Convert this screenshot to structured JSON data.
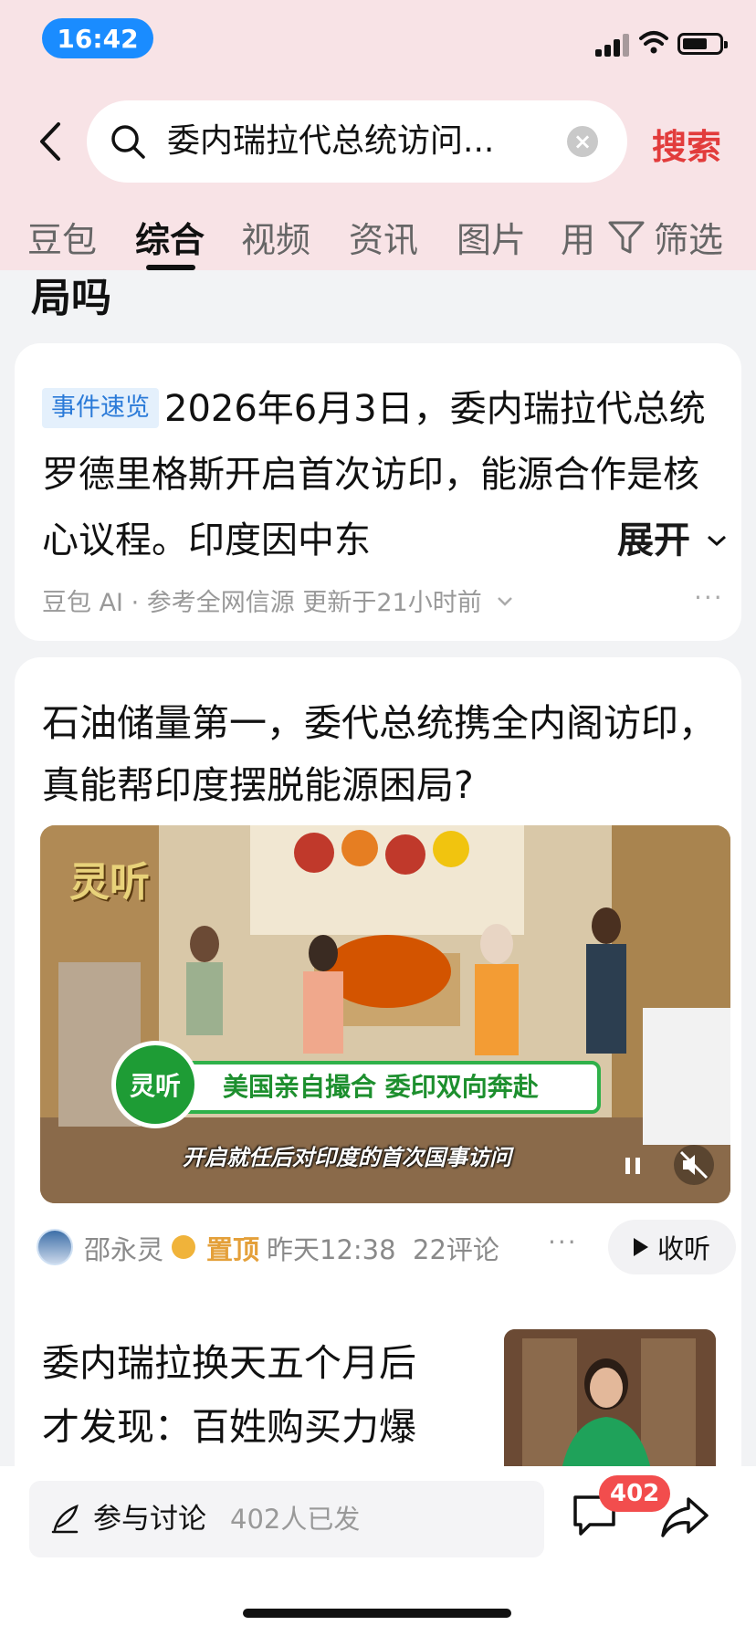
{
  "status_bar": {
    "time": "16:42"
  },
  "search": {
    "query": "委内瑞拉代总统访问...",
    "submit_label": "搜索"
  },
  "tabs": [
    {
      "label": "豆包"
    },
    {
      "label": "综合",
      "active": true
    },
    {
      "label": "视频"
    },
    {
      "label": "资讯"
    },
    {
      "label": "图片"
    },
    {
      "label": "用"
    }
  ],
  "filter_label": "筛选",
  "partial_title": "局吗",
  "ai_summary": {
    "badge": "事件速览",
    "body": "2026年6月3日，委内瑞拉代总统罗德里格斯开启首次访印，能源合作是核心议程。印度因中东",
    "expand_label": "展开",
    "meta": "豆包 AI · 参考全网信源  更新于21小时前"
  },
  "news_item_1": {
    "title": "石油储量第一，委代总统携全内阁访印，真能帮印度摆脱能源困局?",
    "video": {
      "watermark": "灵听",
      "logo_text": "灵听",
      "banner": "美国亲自撮合 委印双向奔赴",
      "subtitle": "开启就任后对印度的首次国事访问"
    },
    "author": "邵永灵",
    "pinned": "置顶",
    "time": "昨天12:38",
    "comments": "22评论",
    "listen_label": "收听"
  },
  "news_item_2": {
    "title": "委内瑞拉换天五个月后才发现：百姓购买力爆"
  },
  "bottom_bar": {
    "discuss_label": "参与讨论",
    "discuss_count": "402人已发",
    "comment_badge": "402"
  },
  "colors": {
    "header_bg": "#f8e3e6",
    "accent_red": "#e23c3c",
    "badge_blue": "#2a7ad8",
    "pin_orange": "#e4a03a",
    "time_pill": "#1a8cff"
  }
}
